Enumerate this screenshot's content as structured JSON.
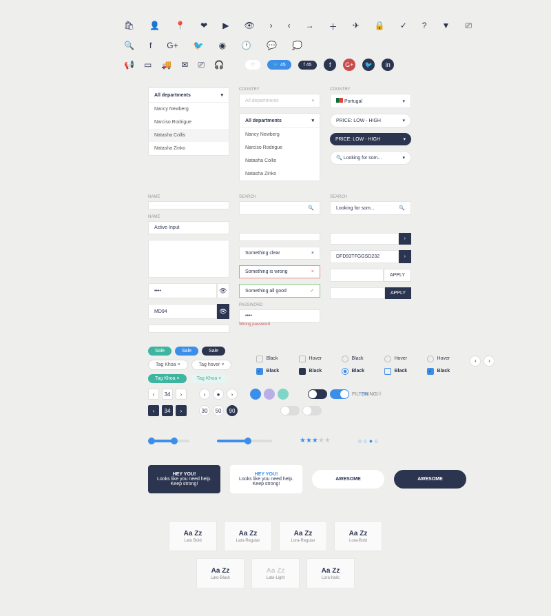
{
  "dropdowns": {
    "all_departments": "All departments",
    "items": [
      "Nancy Newberg",
      "Narciso Rodrigue",
      "Natasha Collis",
      "Natasha Zinko"
    ],
    "country_label": "COUNTRY",
    "country_value": "Portugal",
    "price_sort": "PRICE: LOW - HIGH",
    "looking": "Looking for som..."
  },
  "inputs": {
    "name_label": "NAME",
    "search_label": "SEARCH",
    "active": "Active Input",
    "something_clear": "Something clear",
    "something_wrong": "Something is wrong",
    "something_good": "Something all good",
    "code": "DFD93TFGGSD232",
    "apply": "APPLY",
    "password_label": "PASSWORD",
    "password_val": "••••",
    "password_vis": "MD94",
    "password_hint": "Wrong password"
  },
  "tags": {
    "sale": "Sale",
    "tag_khoa": "Tag Khoa",
    "tag_hover": "Tag hover"
  },
  "checkboxes": {
    "black": "Black",
    "hover": "Hover"
  },
  "filtering": {
    "label": "FILTERING:",
    "on": "On",
    "off": "Off"
  },
  "pagination": {
    "pages": [
      "34",
      "30",
      "50",
      "90"
    ]
  },
  "tooltips": {
    "hey": "HEY YOU!",
    "msg": "Looks like you need help. Keep strong!",
    "awesome": "AWESOME"
  },
  "fonts": [
    {
      "sample": "Aa Zz",
      "name": "Lato Bold"
    },
    {
      "sample": "Aa Zz",
      "name": "Lato-Regular"
    },
    {
      "sample": "Aa Zz",
      "name": "Lora-Regular"
    },
    {
      "sample": "Aa Zz",
      "name": "Lora-Bold"
    },
    {
      "sample": "Aa Zz",
      "name": "Lato-Black"
    },
    {
      "sample": "Aa Zz",
      "name": "Lato-Light"
    },
    {
      "sample": "Aa Zz",
      "name": "Lora-Italic"
    }
  ]
}
